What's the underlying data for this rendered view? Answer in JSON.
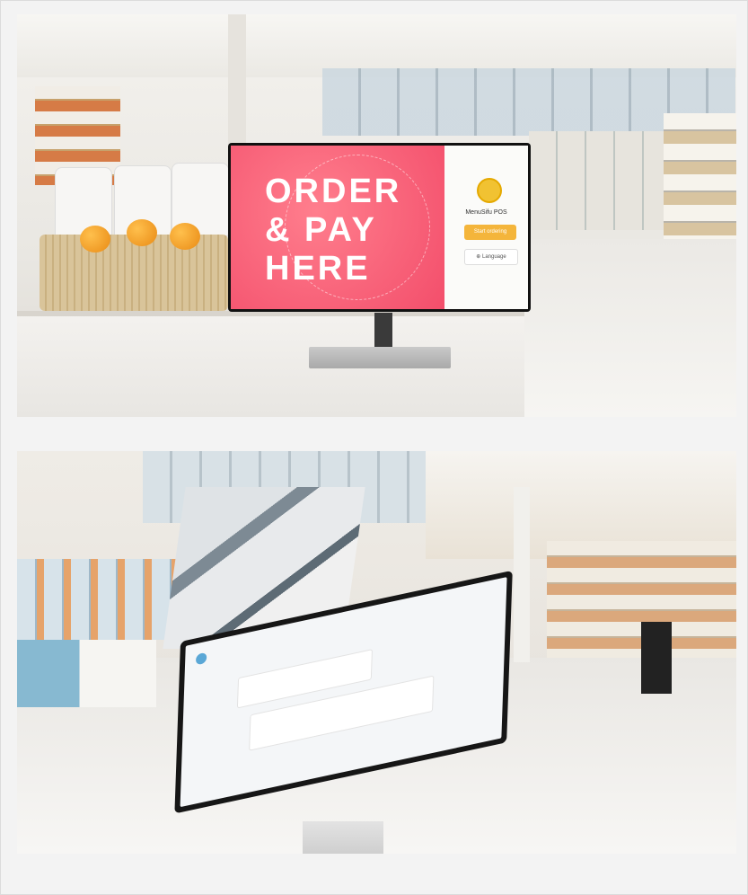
{
  "photo_top": {
    "screen": {
      "promo_text": "ORDER\n& PAY\nHERE",
      "brand_name": "MenuSifu POS",
      "start_button": "Start ordering",
      "language_button": "⊕ Language"
    },
    "colors": {
      "promo": "#f34e6b",
      "start_button": "#f4b53b",
      "logo": "#f1c232"
    }
  },
  "photo_bottom": {
    "tablet": {
      "brand_name": "",
      "card1_title": "",
      "card2_text": ""
    }
  }
}
